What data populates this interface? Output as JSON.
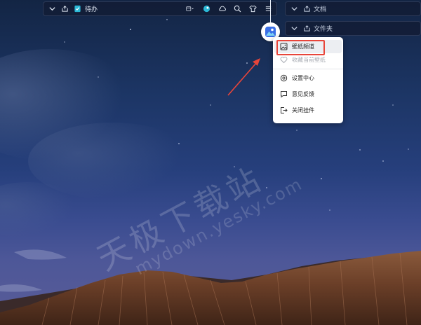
{
  "todo_bar": {
    "title": "待办"
  },
  "panels": [
    {
      "title": "文档"
    },
    {
      "title": "文件夹"
    }
  ],
  "menu": {
    "items": [
      {
        "label": "壁纸频道",
        "icon": "image-icon",
        "state": "selected"
      },
      {
        "label": "收藏当前壁纸",
        "icon": "heart-icon",
        "state": "disabled"
      },
      {
        "label": "设置中心",
        "icon": "settings-icon",
        "state": "normal"
      },
      {
        "label": "意见反馈",
        "icon": "feedback-icon",
        "state": "normal"
      },
      {
        "label": "关闭挂件",
        "icon": "exit-icon",
        "state": "normal"
      }
    ]
  },
  "watermark": {
    "cn": "天极下载站",
    "url": "mydown.yesky.com"
  },
  "colors": {
    "highlight": "#e8453a",
    "accent_teal": "#2bb8d6",
    "menu_bg": "#ffffff"
  }
}
